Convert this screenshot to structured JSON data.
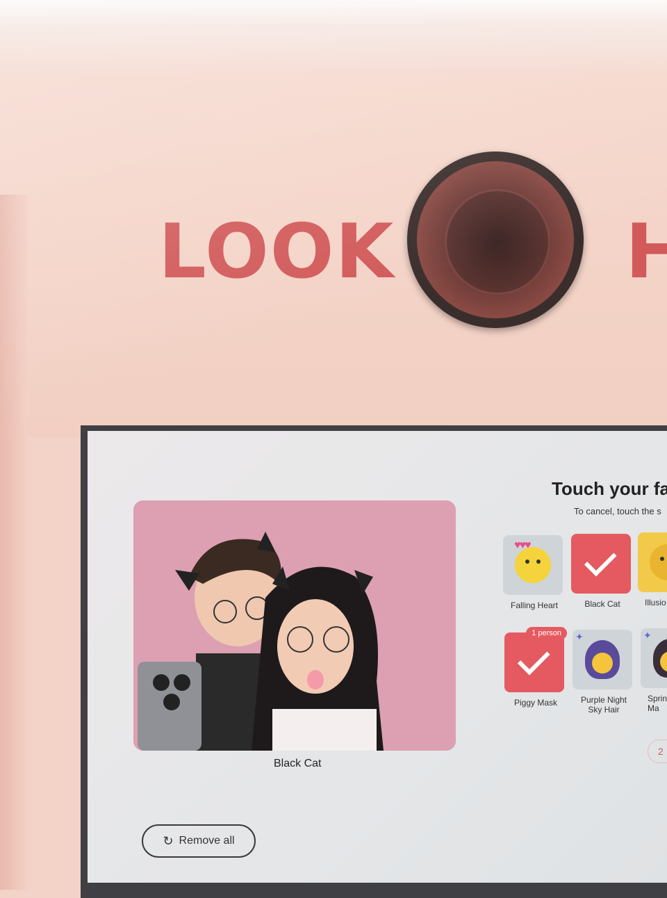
{
  "booth": {
    "sign_left": "LOOK",
    "sign_right": "H"
  },
  "screen": {
    "title": "Touch your fa",
    "subtitle": "To cancel, touch the s",
    "preview_label": "Black Cat",
    "remove_all_label": "Remove all",
    "page_indicator": "2",
    "filters": [
      {
        "label": "Falling Heart",
        "selected": false
      },
      {
        "label": "Black Cat",
        "selected": true
      },
      {
        "label": "Illusio",
        "selected": false
      },
      {
        "label": "Piggy Mask",
        "selected": true,
        "badge": "1 person"
      },
      {
        "label": "Purple Night\nSky Hair",
        "selected": false
      },
      {
        "label": "Spring\nMa",
        "selected": false
      }
    ]
  },
  "colors": {
    "accent_red": "#e55a60",
    "sign_red": "#d25a5a",
    "booth_pink": "#f3d2c7"
  },
  "icons": {
    "remove_all": "refresh-icon",
    "selected": "check-icon"
  }
}
